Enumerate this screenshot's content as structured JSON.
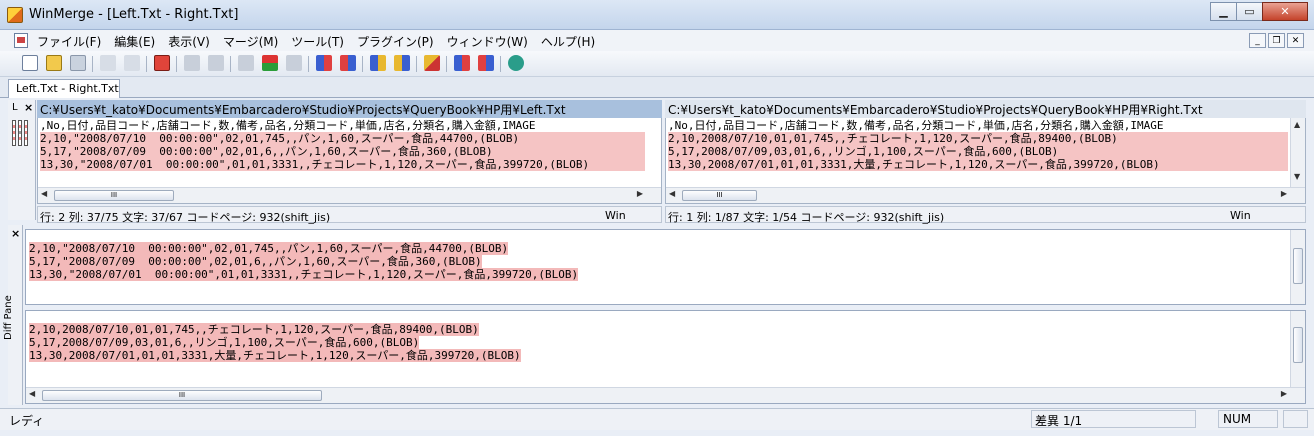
{
  "window": {
    "title": "WinMerge - [Left.Txt - Right.Txt]",
    "minimize": "▁",
    "maximize": "▭",
    "close": "✕"
  },
  "menu": [
    "ファイル(F)",
    "編集(E)",
    "表示(V)",
    "マージ(M)",
    "ツール(T)",
    "プラグイン(P)",
    "ウィンドウ(W)",
    "ヘルプ(H)"
  ],
  "mdi": {
    "minimize": "_",
    "restore": "❐",
    "close": "✕"
  },
  "tab": {
    "label": "Left.Txt - Right.Txt"
  },
  "gutter": {
    "location_label": "L",
    "close": "×"
  },
  "left": {
    "path": "C:¥Users¥t_kato¥Documents¥Embarcadero¥Studio¥Projects¥QueryBook¥HP用¥Left.Txt",
    "lines": [
      ",No,日付,品目コード,店舗コード,数,備考,品名,分類コード,単価,店名,分類名,購入金額,IMAGE",
      "2,10,\"2008/07/10  00:00:00\",02,01,745,,パン,1,60,スーパー,食品,44700,(BLOB)",
      "5,17,\"2008/07/09  00:00:00\",02,01,6,,パン,1,60,スーパー,食品,360,(BLOB)",
      "13,30,\"2008/07/01  00:00:00\",01,01,3331,,チェコレート,1,120,スーパー,食品,399720,(BLOB)"
    ],
    "status": "行: 2  列: 37/75  文字: 37/67  コードページ: 932(shift_jis)",
    "eol": "Win"
  },
  "right": {
    "path": "C:¥Users¥t_kato¥Documents¥Embarcadero¥Studio¥Projects¥QueryBook¥HP用¥Right.Txt",
    "lines": [
      ",No,日付,品目コード,店舗コード,数,備考,品名,分類コード,単価,店名,分類名,購入金額,IMAGE",
      "2,10,2008/07/10,01,01,745,,チェコレート,1,120,スーパー,食品,89400,(BLOB)",
      "5,17,2008/07/09,03,01,6,,リンゴ,1,100,スーパー,食品,600,(BLOB)",
      "13,30,2008/07/01,01,01,3331,大量,チェコレート,1,120,スーパー,食品,399720,(BLOB)"
    ],
    "status": "行: 1  列: 1/87  文字: 1/54  コードページ: 932(shift_jis)",
    "eol": "Win"
  },
  "diff_pane": {
    "label": "Diff Pane",
    "close": "×",
    "top_lines": [
      "2,10,\"2008/07/10  00:00:00\",02,01,745,,パン,1,60,スーパー,食品,44700,(BLOB)",
      "5,17,\"2008/07/09  00:00:00\",02,01,6,,パン,1,60,スーパー,食品,360,(BLOB)",
      "13,30,\"2008/07/01  00:00:00\",01,01,3331,,チェコレート,1,120,スーパー,食品,399720,(BLOB)"
    ],
    "bottom_lines": [
      "2,10,2008/07/10,01,01,745,,チェコレート,1,120,スーパー,食品,89400,(BLOB)",
      "5,17,2008/07/09,03,01,6,,リンゴ,1,100,スーパー,食品,600,(BLOB)",
      "13,30,2008/07/01,01,01,3331,大量,チェコレート,1,120,スーパー,食品,399720,(BLOB)"
    ]
  },
  "statusbar": {
    "ready": "レディ",
    "diff_count": "差異 1/1",
    "num": "NUM"
  },
  "scroll": {
    "left_arrow": "◀",
    "right_arrow": "▶",
    "up_arrow": "▲",
    "down_arrow": "▼",
    "thumb": "III"
  },
  "toolbar_icons": [
    "new-icon",
    "open-icon",
    "save-icon",
    "undo-icon",
    "redo-icon",
    "options-icon",
    "prev-diff-icon",
    "next-diff-icon",
    "first-diff-icon",
    "current-diff-icon",
    "last-diff-icon",
    "copy-right-icon",
    "copy-left-icon",
    "copy-right-advance-icon",
    "copy-left-advance-icon",
    "all-right-icon",
    "all-left-icon",
    "refresh-icon"
  ],
  "colors": {
    "diff_line": "#f5c4c4",
    "diff_pane_line": "#f3b9b9",
    "active_header": "#a8c0dd"
  }
}
